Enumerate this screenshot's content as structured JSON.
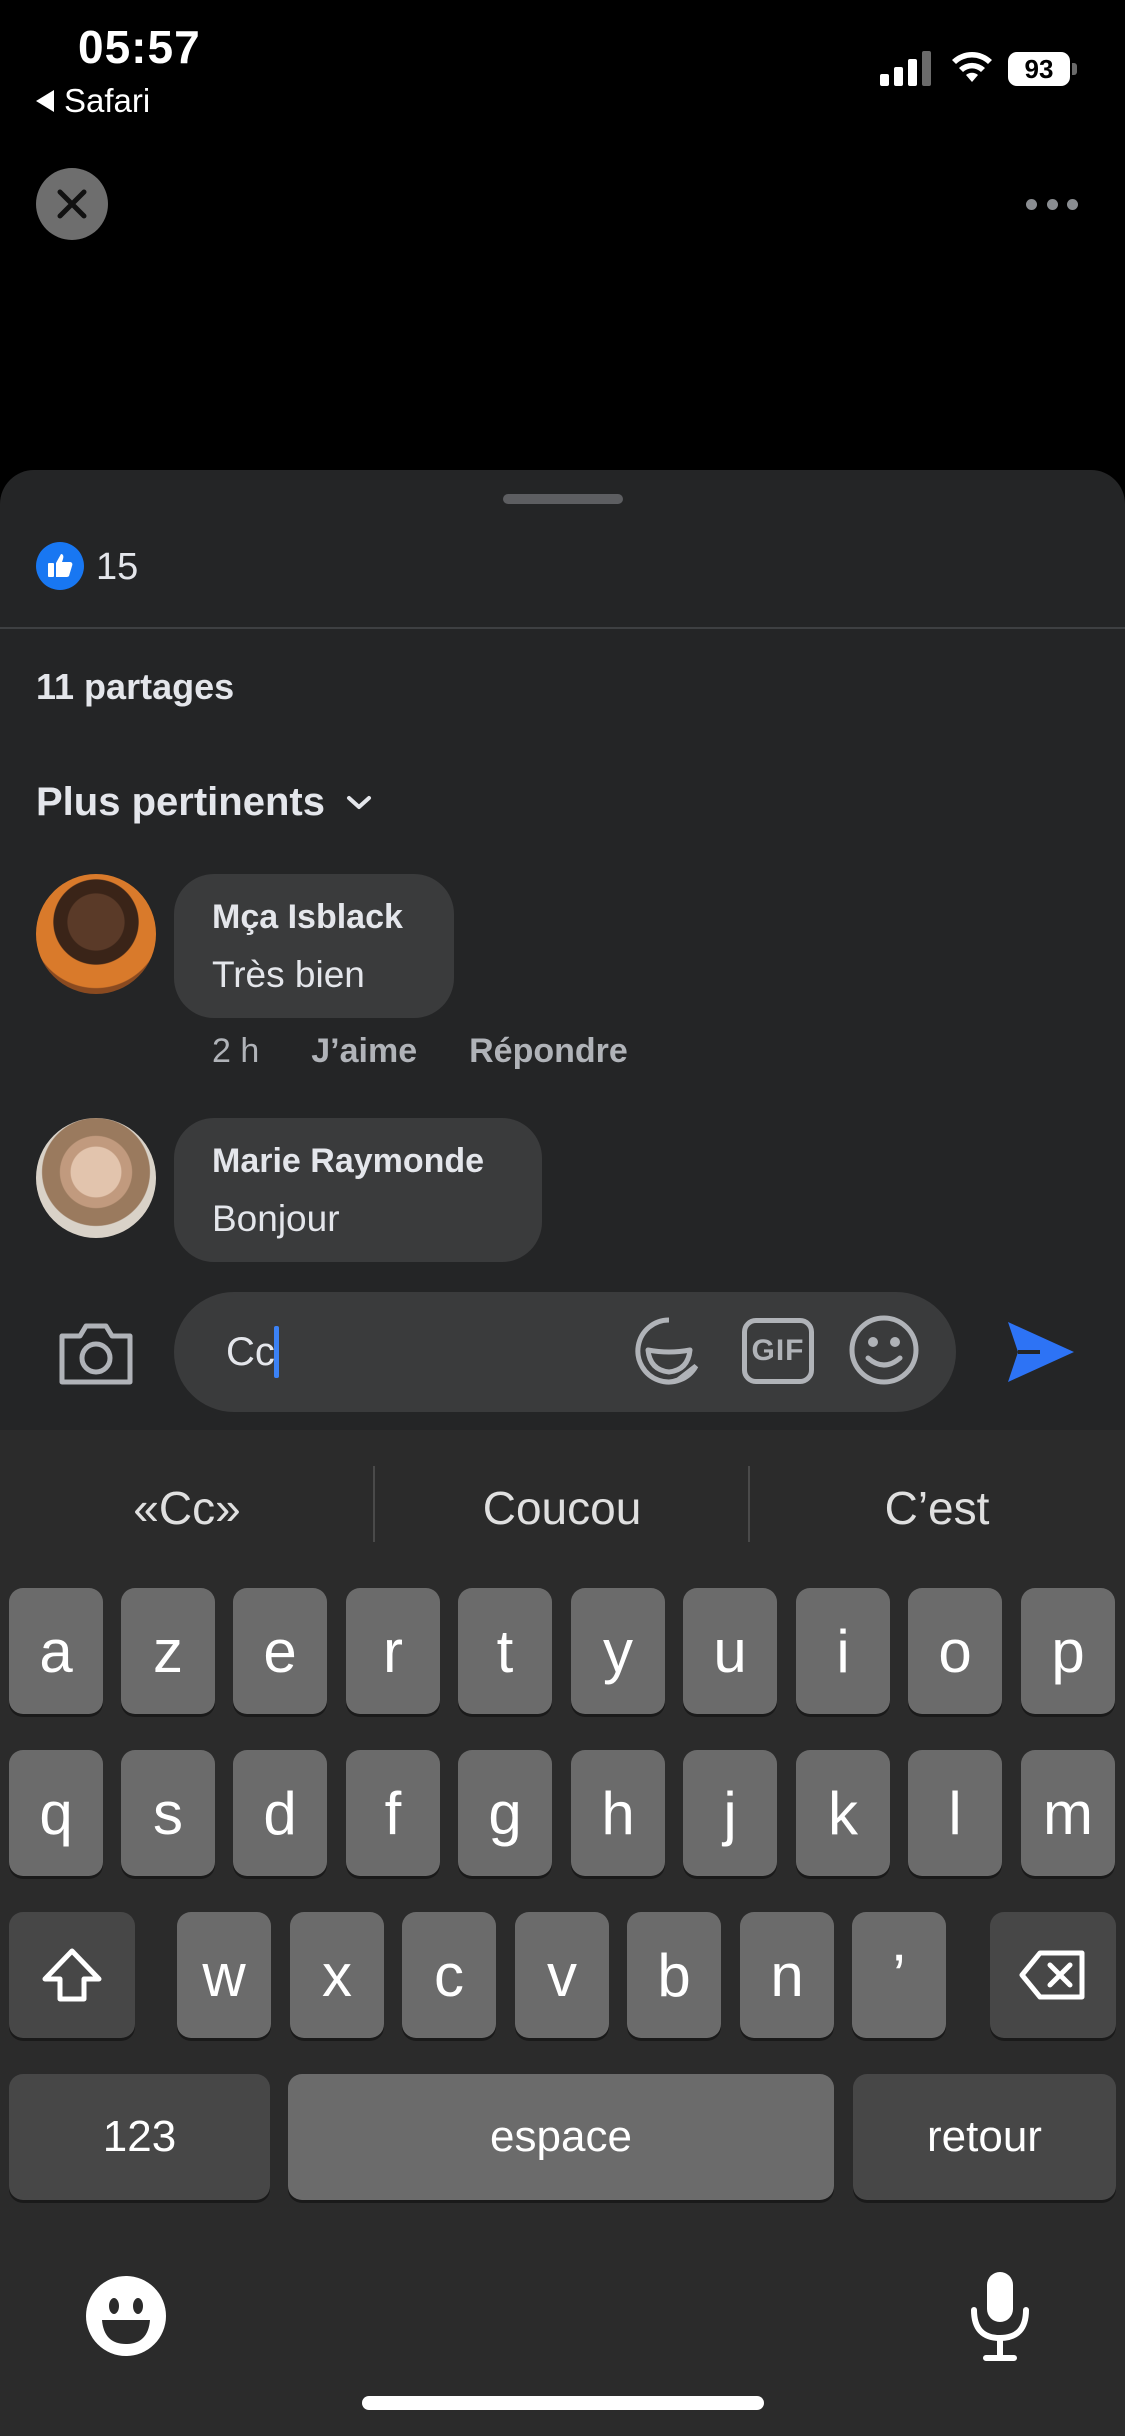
{
  "status": {
    "time": "05:57",
    "back_label": "Safari",
    "battery": "93"
  },
  "reactions": {
    "like_count": "15",
    "shares": "11 partages"
  },
  "sort": {
    "label": "Plus pertinents"
  },
  "comments": [
    {
      "author": "Mça Isblack",
      "text": "Très bien",
      "time": "2 h",
      "like_label": "J’aime",
      "reply_label": "Répondre"
    },
    {
      "author": "Marie Raymonde",
      "text": "Bonjour"
    }
  ],
  "composer": {
    "value": "Cc",
    "gif_label": "GIF"
  },
  "keyboard": {
    "predictions": [
      "«Cc»",
      "Coucou",
      "C’est"
    ],
    "row1": [
      "a",
      "z",
      "e",
      "r",
      "t",
      "y",
      "u",
      "i",
      "o",
      "p"
    ],
    "row2": [
      "q",
      "s",
      "d",
      "f",
      "g",
      "h",
      "j",
      "k",
      "l",
      "m"
    ],
    "row3": [
      "w",
      "x",
      "c",
      "v",
      "b",
      "n",
      "’"
    ],
    "numbers_label": "123",
    "space_label": "espace",
    "return_label": "retour"
  },
  "colors": {
    "accent": "#1877f2",
    "send": "#2d73f5",
    "sheet": "#242526",
    "bubble": "#3a3b3c"
  },
  "icons": [
    "close-icon",
    "more-icon",
    "like-icon",
    "chevron-down-icon",
    "camera-icon",
    "sticker-icon",
    "gif-icon",
    "emoji-icon",
    "send-icon",
    "shift-icon",
    "backspace-icon",
    "emoji-keyboard-icon",
    "microphone-icon"
  ]
}
